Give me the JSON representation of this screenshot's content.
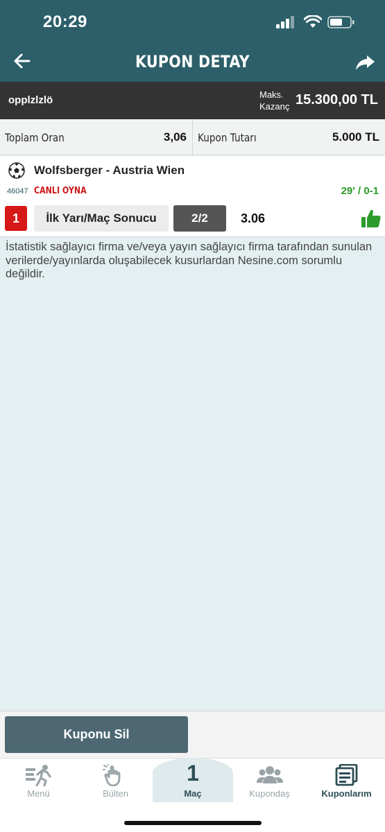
{
  "status_bar": {
    "time": "20:29"
  },
  "header": {
    "title": "KUPON DETAY"
  },
  "summary": {
    "username": "opplzlzlö",
    "max_win_label_1": "Maks.",
    "max_win_label_2": "Kazanç",
    "max_win_value": "15.300,00 TL"
  },
  "totals": {
    "total_odds_label": "Toplam Oran",
    "total_odds_value": "3,06",
    "coupon_amount_label": "Kupon Tutarı",
    "coupon_amount_value": "5.000 TL"
  },
  "match": {
    "teams": "Wolfsberger - Austria Wien",
    "code": "46047",
    "live_label": "CANLI OYNA",
    "live_score": "29' / 0-1",
    "pick_number": "1",
    "market": "İlk Yarı/Maç Sonucu",
    "selection": "2/2",
    "odd": "3.06"
  },
  "disclaimer": "İstatistik sağlayıcı firma ve/veya yayın sağlayıcı firma tarafından sunulan verilerde/yayınlarda oluşabilecek kusurlardan Nesine.com sorumlu değildir.",
  "actions": {
    "delete_label": "Kuponu Sil"
  },
  "tabbar": {
    "menu": "Menü",
    "bulletin": "Bülten",
    "match_count": "1",
    "match": "Maç",
    "kupondas": "Kupondaş",
    "kuponlarim": "Kuponlarım"
  },
  "colors": {
    "header_bg": "#2c5f69",
    "summary_bg": "#333333",
    "live_red": "#cc1a1a",
    "score_green": "#2c9b2c",
    "delete_button": "#4d6873"
  }
}
